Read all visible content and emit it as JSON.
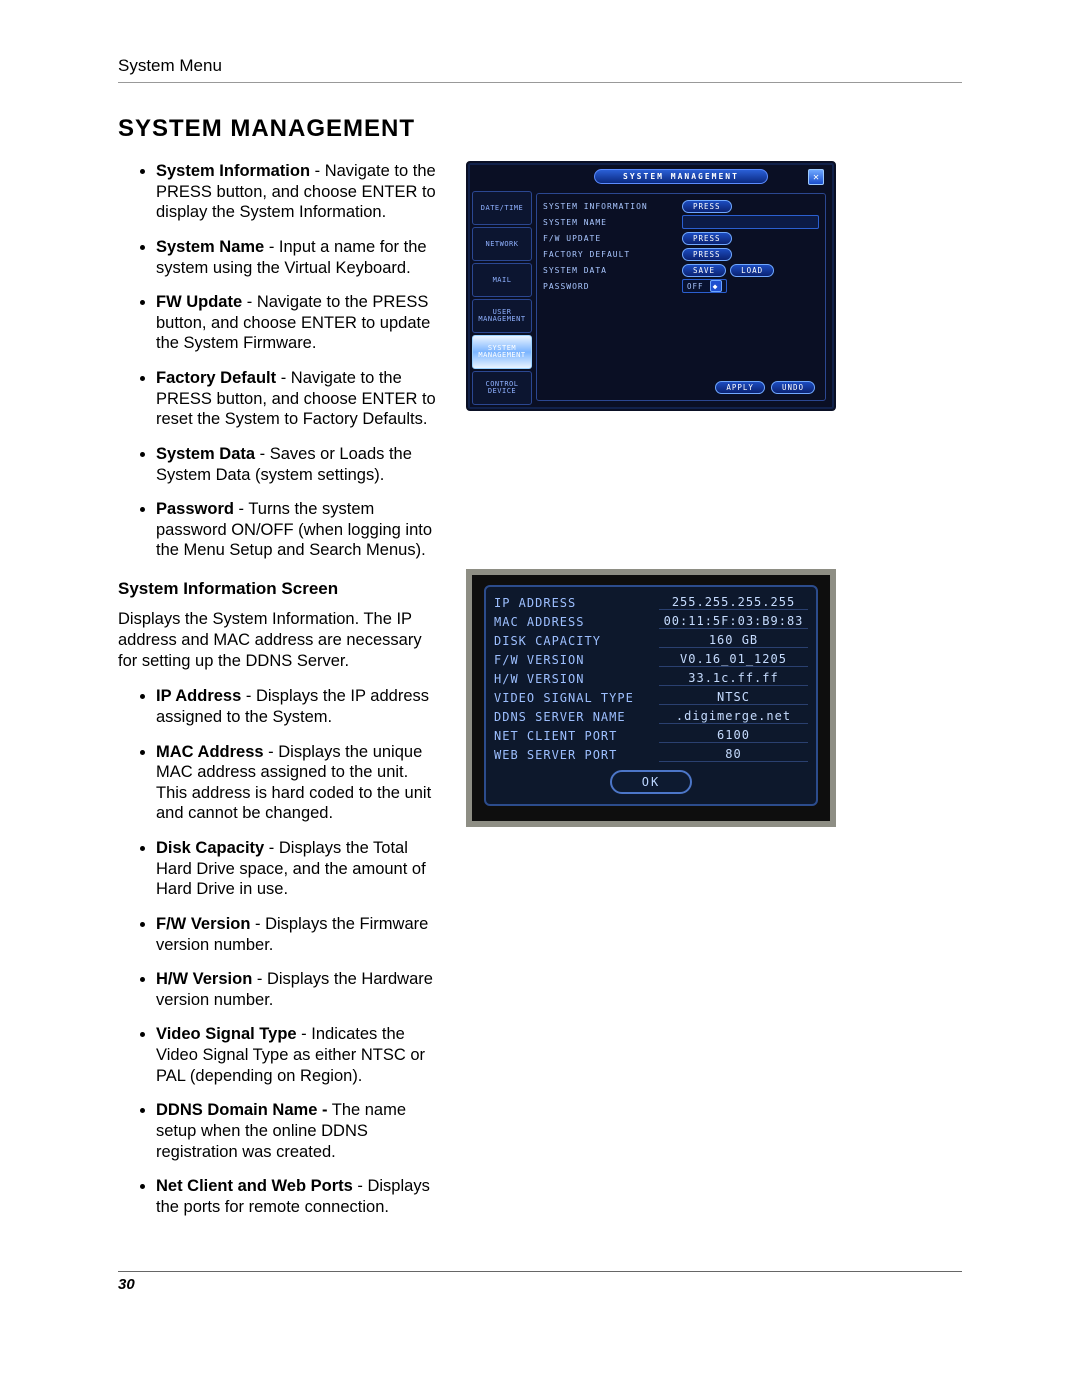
{
  "header": "System Menu",
  "title": "SYSTEM MANAGEMENT",
  "bullets1": [
    {
      "term": "System Information",
      "desc": " - Navigate to the PRESS button, and choose ENTER to display the System Information."
    },
    {
      "term": "System Name",
      "desc": " - Input a name for the system using the Virtual Keyboard."
    },
    {
      "term": "FW Update",
      "desc": " - Navigate to the PRESS button, and choose ENTER to update the System Firmware."
    },
    {
      "term": "Factory Default",
      "desc": " - Navigate to the PRESS button, and choose ENTER to reset the System to Factory Defaults."
    },
    {
      "term": "System Data",
      "desc": " - Saves or Loads the System Data (system settings)."
    },
    {
      "term": "Password",
      "desc": " - Turns the system password ON/OFF (when logging into the Menu Setup and Search Menus)."
    }
  ],
  "subhead": "System Information Screen",
  "para1": "Displays the System Information. The IP address and MAC address are necessary for setting up the DDNS Server.",
  "bullets2": [
    {
      "term": "IP Address",
      "desc": " - Displays the IP address assigned to the System."
    },
    {
      "term": "MAC Address",
      "desc": " - Displays the unique MAC address assigned to the unit. This address is hard coded to the unit and cannot be changed."
    },
    {
      "term": "Disk Capacity",
      "desc": " - Displays the Total Hard Drive space, and the amount of Hard Drive in use."
    },
    {
      "term": "F/W Version",
      "desc": " - Displays the Firmware version number."
    },
    {
      "term": "H/W Version",
      "desc": " - Displays the Hardware version number."
    },
    {
      "term": "Video Signal Type",
      "desc": " - Indicates the Video Signal Type as either NTSC or PAL (depending on Region)."
    },
    {
      "term": "DDNS Domain Name -",
      "desc": " The name setup when the online DDNS registration was created."
    },
    {
      "term": "Net Client and Web Ports",
      "desc": " - Displays the ports for remote connection."
    }
  ],
  "page_no": "30",
  "sm": {
    "title": "SYSTEM MANAGEMENT",
    "close_glyph": "✕",
    "tabs": [
      "DATE/TIME",
      "NETWORK",
      "MAIL",
      "USER\nMANAGEMENT",
      "SYSTEM\nMANAGEMENT",
      "CONTROL\nDEVICE"
    ],
    "rows": {
      "sys_info": "SYSTEM INFORMATION",
      "sys_name": "SYSTEM NAME",
      "fw_update": "F/W UPDATE",
      "factory": "FACTORY DEFAULT",
      "sys_data": "SYSTEM DATA",
      "password": "PASSWORD"
    },
    "btn_press": "PRESS",
    "btn_save": "SAVE",
    "btn_load": "LOAD",
    "password_state": "OFF",
    "apply": "APPLY",
    "undo": "UNDO"
  },
  "info": {
    "rows": [
      {
        "k": "IP ADDRESS",
        "v": "255.255.255.255"
      },
      {
        "k": "MAC ADDRESS",
        "v": "00:11:5F:03:B9:83"
      },
      {
        "k": "DISK CAPACITY",
        "v": "160 GB"
      },
      {
        "k": "F/W VERSION",
        "v": "V0.16_01_1205"
      },
      {
        "k": "H/W VERSION",
        "v": "33.1c.ff.ff"
      },
      {
        "k": "VIDEO SIGNAL TYPE",
        "v": "NTSC"
      },
      {
        "k": "DDNS SERVER NAME",
        "v": ".digimerge.net"
      },
      {
        "k": "NET CLIENT PORT",
        "v": "6100"
      },
      {
        "k": "WEB SERVER PORT",
        "v": "80"
      }
    ],
    "ok": "OK"
  }
}
